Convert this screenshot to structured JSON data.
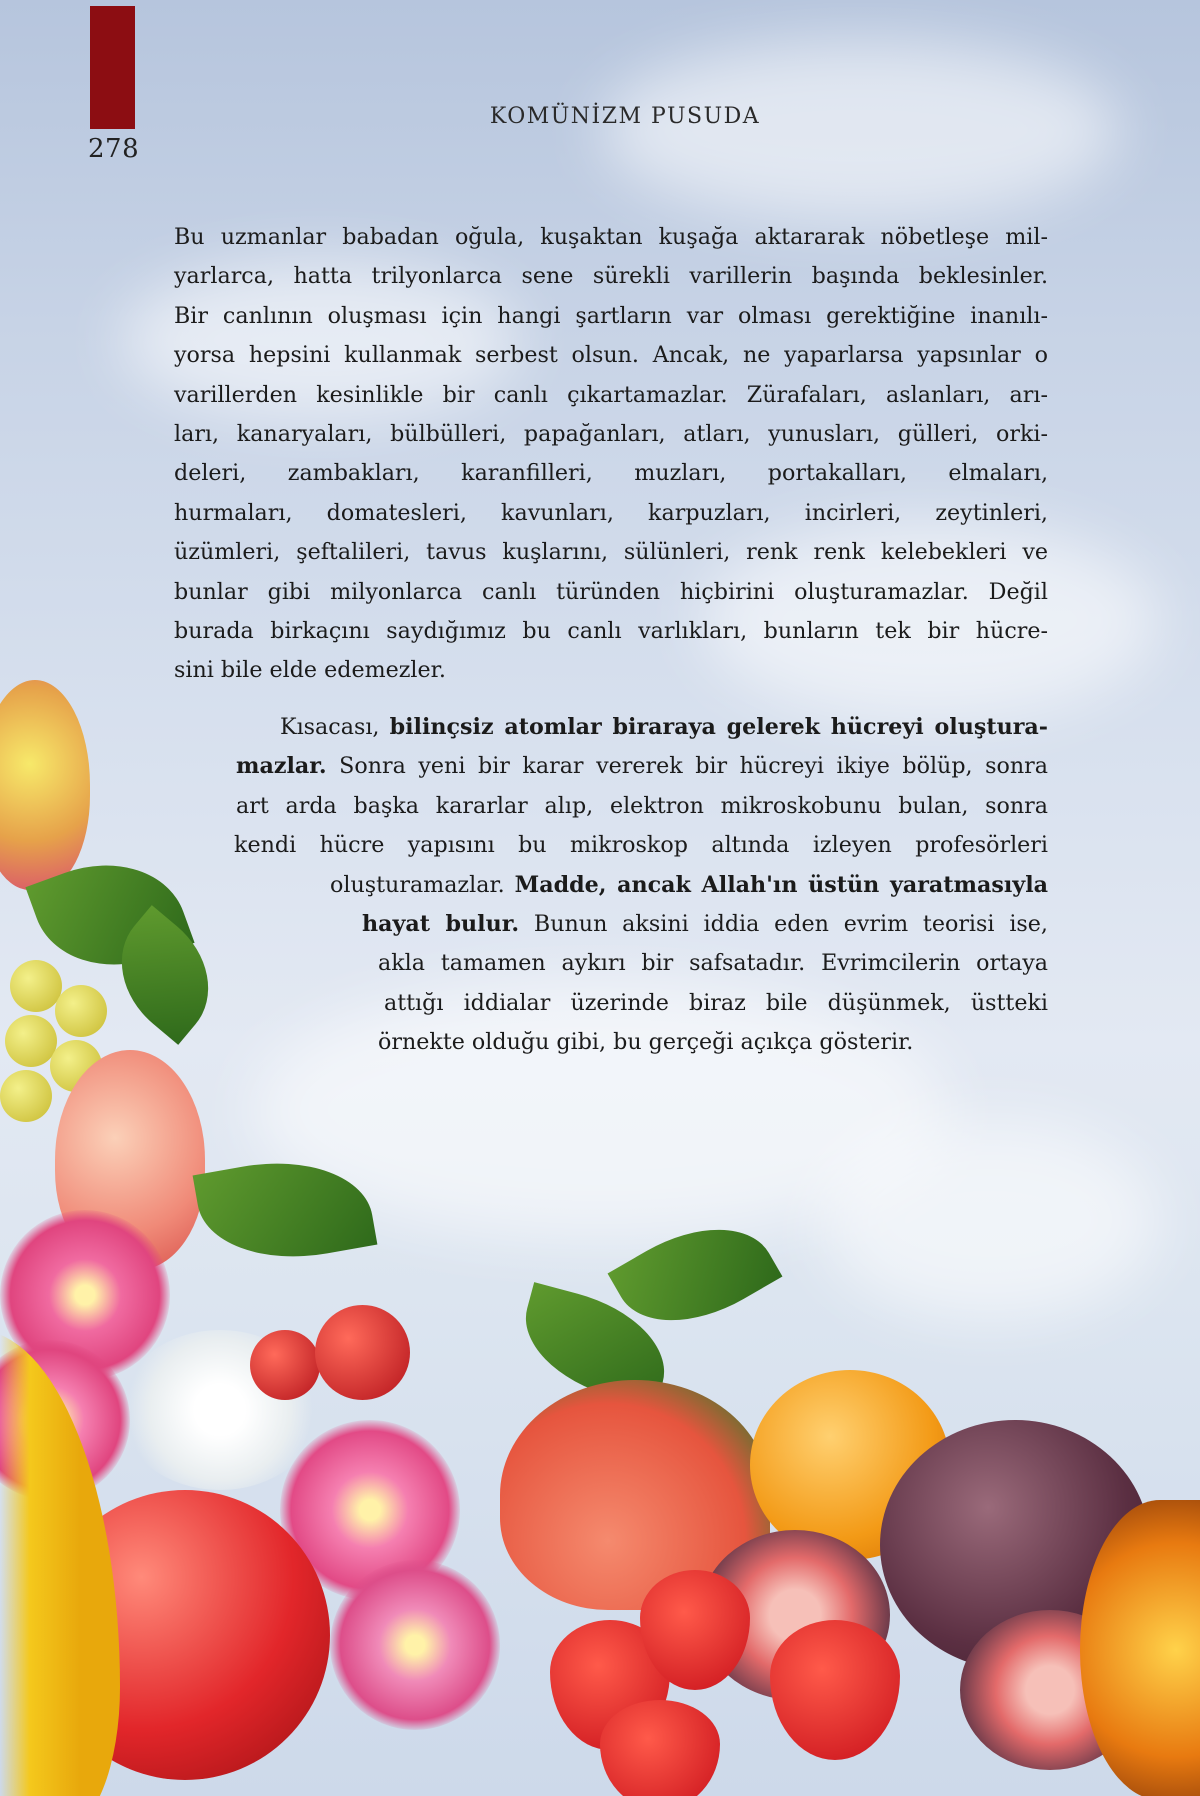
{
  "header": {
    "page_number": "278",
    "running_title": "KOMÜNİZM PUSUDA"
  },
  "paragraph_1": {
    "lines": [
      "Bu uzmanlar babadan oğula, kuşaktan kuşağa aktararak nöbetleşe mil-",
      "yarlarca, hatta trilyonlarca sene sürekli varillerin başında beklesinler.",
      "Bir canlının oluşması için hangi şartların var olması gerektiğine inanılı-",
      "yorsa hepsini kullanmak serbest olsun. Ancak, ne yaparlarsa yapsınlar o",
      "varillerden kesinlikle bir canlı çıkartamazlar. Zürafaları, aslanları, arı-",
      "ları, kanaryaları, bülbülleri, papağanları, atları, yunusları, gülleri, orki-",
      "deleri, zambakları, karanfilleri, muzları, portakalları, elmaları,",
      "hurmaları, domatesleri, kavunları, karpuzları, incirleri, zeytinleri,",
      "üzümleri, şeftalileri, tavus kuşlarını, sülünleri, renk renk kelebekleri ve",
      "bunlar gibi milyonlarca canlı türünden hiçbirini oluşturamazlar. Değil",
      "burada birkaçını saydığımız bu canlı varlıkları, bunların tek bir hücre-",
      "sini bile elde edemezler."
    ]
  },
  "paragraph_2": {
    "l1_a": "Kısacası, ",
    "l1_b": "bilinçsiz atomlar biraraya gelerek hücreyi oluştura-",
    "l2_a": "mazlar.",
    "l2_b": " Sonra yeni bir karar vererek bir hücreyi ikiye bölüp, sonra",
    "l3": "art arda başka kararlar alıp, elektron mikroskobunu bulan, sonra",
    "l4": "kendi hücre yapısını bu mikroskop altında izleyen profesörleri",
    "l5_a": "oluşturamazlar. ",
    "l5_b": "Madde, ancak Allah'ın üstün yaratmasıyla",
    "l6_a": "hayat bulur.",
    "l6_b": " Bunun aksini iddia eden evrim teorisi ise,",
    "l7": "akla tamamen aykırı bir safsatadır. Evrimcilerin ortaya",
    "l8": "attığı iddialar üzerinde biraz bile düşünmek, üstteki",
    "l9": "örnekte olduğu gibi, bu gerçeği açıkça gösterir."
  },
  "colors": {
    "bookmark": "#8c0d12",
    "sky_top": "#b6c5dd",
    "sky_mid": "#e3e9f3"
  }
}
